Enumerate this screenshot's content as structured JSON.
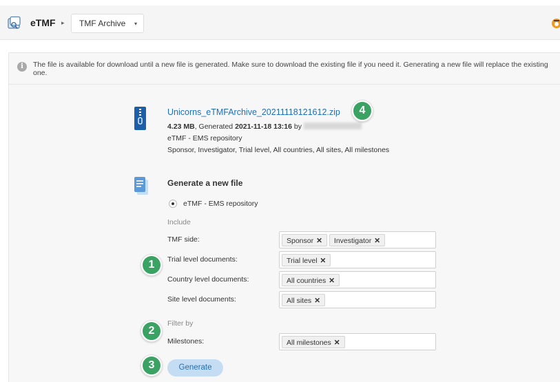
{
  "header": {
    "app_name": "eTMF",
    "breadcrumb_sep": "▸",
    "breadcrumb_label": "TMF Archive",
    "breadcrumb_caret": "▾",
    "app_icon": "etmf-app-icon",
    "corner_icon": "help-icon"
  },
  "info": {
    "icon": "info-icon",
    "icon_glyph": "i",
    "text": "The file is available for download until a new file is generated. Make sure to download the existing file if you need it. Generating a new file will replace the existing one."
  },
  "existing_file": {
    "icon": "zip-file-icon",
    "name": "Unicorns_eTMFArchive_20211118121612.zip",
    "size": "4.23 MB",
    "generated_label": ", Generated",
    "generated_at": "2021-11-18 13:16",
    "by_label": "by",
    "repository": "eTMF - EMS repository",
    "scope": "Sponsor, Investigator, Trial level, All countries, All sites, All milestones"
  },
  "generate": {
    "icon": "document-icon",
    "title": "Generate a new file",
    "repository_option": "eTMF - EMS repository",
    "include_label": "Include",
    "filter_label": "Filter by",
    "button_label": "Generate",
    "remove_glyph": "✕",
    "fields": {
      "tmf_side": {
        "label": "TMF side:",
        "tags": [
          "Sponsor",
          "Investigator"
        ]
      },
      "trial_level": {
        "label": "Trial level documents:",
        "tags": [
          "Trial level"
        ]
      },
      "country_level": {
        "label": "Country level documents:",
        "tags": [
          "All countries"
        ]
      },
      "site_level": {
        "label": "Site level documents:",
        "tags": [
          "All sites"
        ]
      },
      "milestones": {
        "label": "Milestones:",
        "tags": [
          "All milestones"
        ]
      }
    }
  },
  "callouts": [
    "1",
    "2",
    "3",
    "4"
  ],
  "colors": {
    "accent": "#1f6fb5",
    "callout": "#3aa363",
    "button_bg": "#c5ddf3",
    "panel_bg": "#f7f7f7"
  }
}
